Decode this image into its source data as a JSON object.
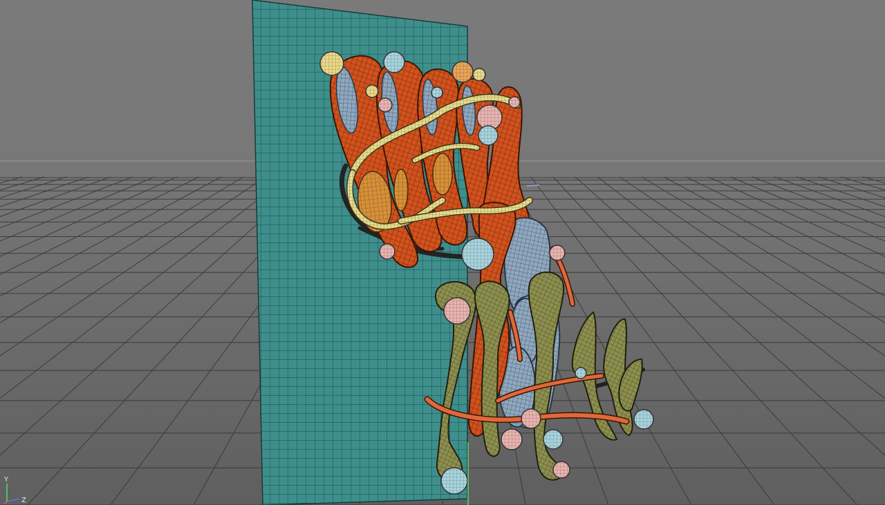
{
  "viewport": {
    "background_top": "#7b7b7b",
    "background_bottom": "#555555",
    "floor_color": "#707070",
    "grid_line_color": "#2f2f2f",
    "horizon_line_color": "#9a9a9a"
  },
  "scene": {
    "backdrop_plane_color": "#3e8f8c",
    "backdrop_wire_color": "#1d4a48",
    "orange_material": "#d2521d",
    "blue_material": "#8fa8bf",
    "olive_material": "#8d8f4f",
    "cream_material": "#e6dc8c",
    "pink_material": "#e8b4b0",
    "cyan_material": "#a9d3dc",
    "rope_material": "#2a2a2a"
  },
  "axis_gizmo": {
    "y_label": "Y",
    "z_label": "Z",
    "y_color": "#59d35a",
    "z_color": "#5a7ae0"
  }
}
